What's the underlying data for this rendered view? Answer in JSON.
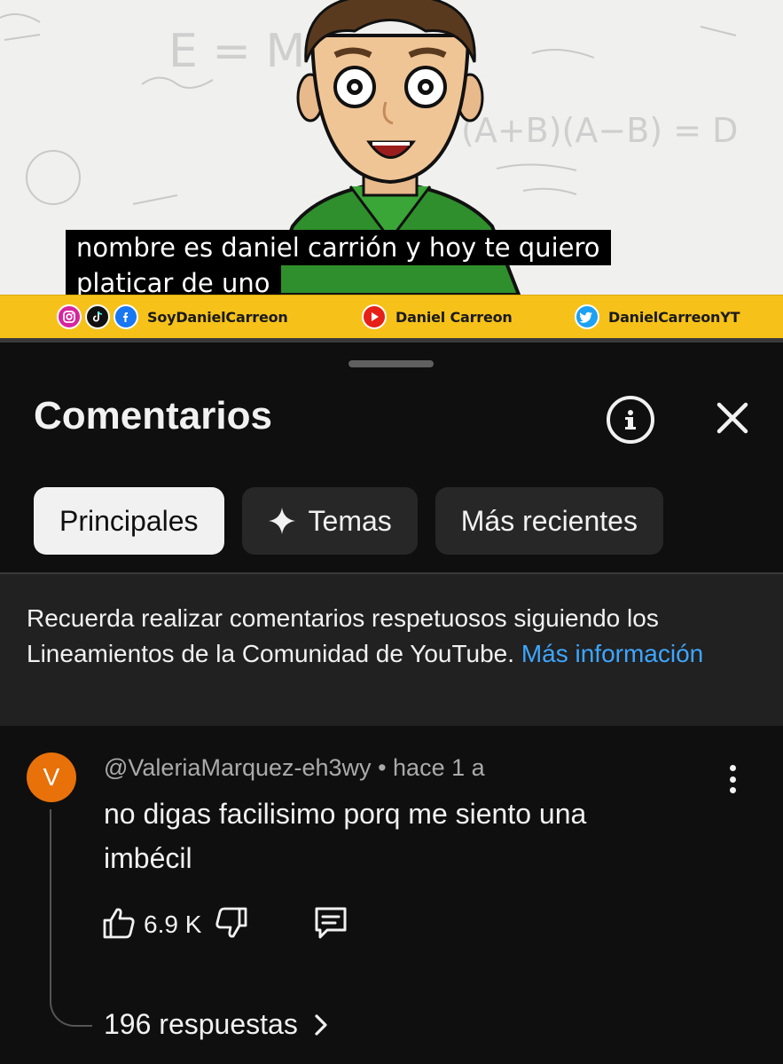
{
  "video": {
    "caption_line1": "nombre es daniel carrión y hoy te quiero",
    "caption_line2": "platicar de uno",
    "socials": {
      "handle_1": "SoyDanielCarreon",
      "handle_2": "Daniel Carreon",
      "handle_3": "DanielCarreonYT"
    },
    "board_formula_1": "E = M",
    "board_formula_2": "(A+B)(A−B) = D"
  },
  "panel": {
    "title": "Comentarios",
    "info_icon": "info-circle-icon",
    "close_icon": "close-icon"
  },
  "filters": {
    "principales": "Principales",
    "temas": "Temas",
    "recientes": "Más recientes"
  },
  "notice": {
    "text": "Recuerda realizar comentarios respetuosos siguiendo los Lineamientos de la Comunidad de YouTube.",
    "link": "Más información"
  },
  "comment": {
    "avatar_letter": "V",
    "avatar_color": "#e8710a",
    "author": "@ValeriaMarquez-eh3wy",
    "separator": "•",
    "time": "hace 1 a",
    "text": "no digas facilisimo porq me siento una imbécil",
    "likes": "6.9 K",
    "replies": "196 respuestas"
  },
  "colors": {
    "background": "#0f0f0f",
    "chip": "#272727",
    "chip_active": "#f1f1f1",
    "link": "#3ea6ff",
    "social_bar": "#f6c21a"
  }
}
